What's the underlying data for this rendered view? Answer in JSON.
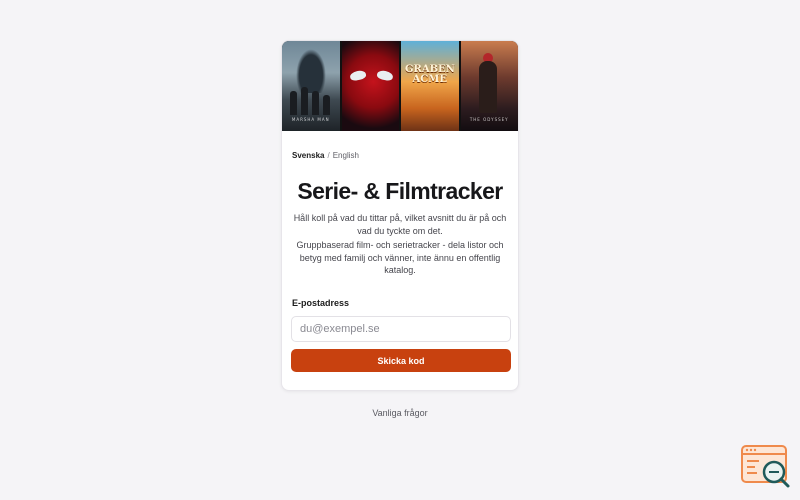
{
  "posters": [
    {
      "title": "MARSHA MAN",
      "name": "poster-1"
    },
    {
      "title": "",
      "name": "poster-2"
    },
    {
      "title": "",
      "name": "poster-3",
      "logo": "GRABEN ACME"
    },
    {
      "title": "THE ODYSSEY",
      "name": "poster-4"
    }
  ],
  "language": {
    "active": "Svenska",
    "separator": "/",
    "other": "English"
  },
  "header": {
    "title": "Serie- & Filmtracker"
  },
  "intro": {
    "line1": "Håll koll på vad du tittar på, vilket avsnitt du är på och vad du tyckte om det.",
    "line2": "Gruppbaserad film- och serietracker - dela listor och betyg med familj och vänner, inte ännu en offentlig katalog."
  },
  "form": {
    "email_label": "E-postadress",
    "email_placeholder": "du@exempel.se",
    "email_value": "",
    "submit_label": "Skicka kod"
  },
  "footer": {
    "faq_label": "Vanliga frågor"
  },
  "colors": {
    "accent": "#c8410f",
    "background": "#f5f4f7",
    "card": "#ffffff"
  },
  "icons": {
    "corner": "search-document-icon"
  }
}
